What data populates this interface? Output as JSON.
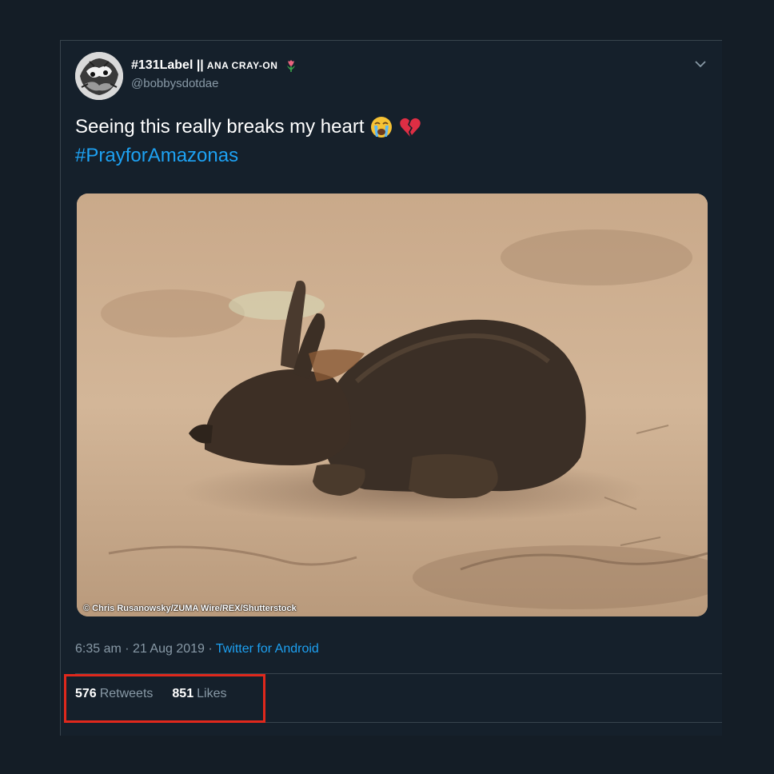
{
  "tweet": {
    "display_name": "#131Label ||",
    "display_name_suffix": "ANA CRAY-ON",
    "handle": "@bobbysdotdae",
    "text_line1": "Seeing this really breaks my heart",
    "hashtag": "#PrayforAmazonas",
    "emojis": [
      "loudly-crying-face-icon",
      "broken-heart-icon"
    ],
    "media_credit": "© Chris Rusanowsky/ZUMA Wire/REX/Shutterstock",
    "time": "6:35 am",
    "date": "21 Aug 2019",
    "separator": "·",
    "source": "Twitter for Android",
    "retweets_count": "576",
    "retweets_label": "Retweets",
    "likes_count": "851",
    "likes_label": "Likes"
  },
  "colors": {
    "background": "#141d26",
    "card": "#15202b",
    "link": "#1da1f2",
    "muted": "#8899a6",
    "highlight": "#e0281c"
  }
}
